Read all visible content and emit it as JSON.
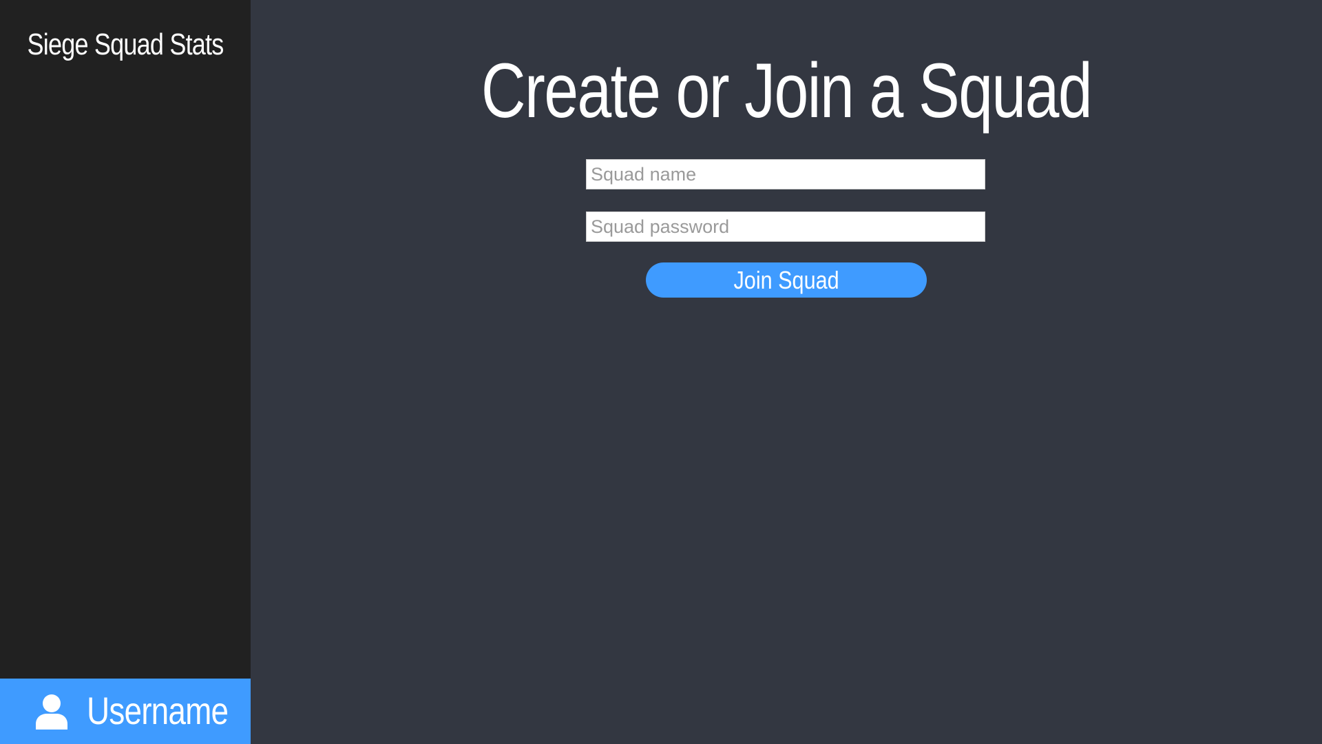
{
  "sidebar": {
    "app_title": "Siege Squad Stats",
    "user": {
      "icon": "user-icon",
      "username": "Username"
    }
  },
  "main": {
    "title": "Create or Join a Squad",
    "squad_name": {
      "value": "",
      "placeholder": "Squad name"
    },
    "squad_password": {
      "value": "",
      "placeholder": "Squad password"
    },
    "join_button_label": "Join Squad"
  },
  "colors": {
    "sidebar_background": "#212121",
    "main_background": "#333741",
    "accent": "#3f9bff",
    "text": "#ffffff"
  }
}
